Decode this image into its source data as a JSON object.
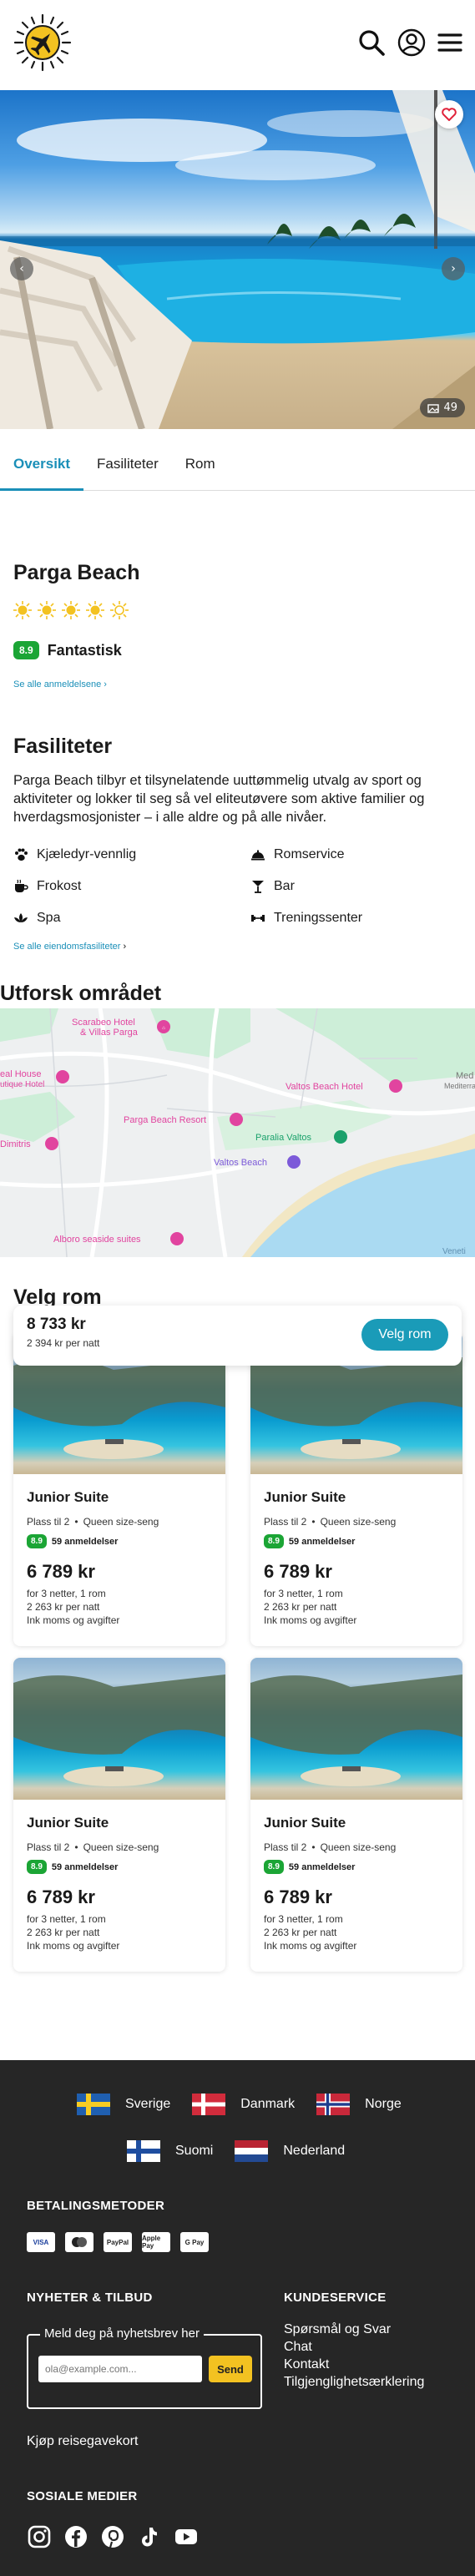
{
  "header": {
    "logo": "sun-plane-logo",
    "icons": [
      "search-icon",
      "user-icon",
      "menu-icon"
    ]
  },
  "hero": {
    "photo_count": "49"
  },
  "tabs": [
    {
      "label": "Oversikt",
      "active": true
    },
    {
      "label": "Fasiliteter",
      "active": false
    },
    {
      "label": "Rom",
      "active": false
    }
  ],
  "hotel": {
    "name": "Parga Beach",
    "sun_rating": 5,
    "score": "8.9",
    "score_label": "Fantastisk",
    "reviews_link": "Se alle anmeldelsene"
  },
  "facilities": {
    "title": "Fasiliteter",
    "description": "Parga Beach tilbyr et tilsynelatende uuttømmelig utvalg av sport og aktiviteter og lokker til seg så vel eliteutøvere som aktive familier og hverdagsmosjonister – i alle aldre og på alle nivåer.",
    "items": [
      {
        "label": "Kjæledyr-vennlig",
        "icon": "paw-icon"
      },
      {
        "label": "Romservice",
        "icon": "cloche-icon"
      },
      {
        "label": "Frokost",
        "icon": "coffee-icon"
      },
      {
        "label": "Bar",
        "icon": "cocktail-icon"
      },
      {
        "label": "Spa",
        "icon": "lotus-icon"
      },
      {
        "label": "Treningssenter",
        "icon": "dumbbell-icon"
      }
    ],
    "all_link": "Se alle eiendomsfasiliteter"
  },
  "area": {
    "title": "Utforsk området",
    "map_labels": {
      "scarabeo": "Scarabeo Hotel",
      "scarabeo2": "& Villas Parga",
      "bh1": "eal House",
      "bh2": "utique Hotel",
      "beach_house": "Valtos Beach Hotel",
      "dimitris": "Dimitris",
      "resort": "Parga Beach Resort",
      "paralia": "Paralia Valtos",
      "valtos": "Valtos Beach",
      "alboro": "Alboro seaside suites",
      "med1": "Med",
      "med2": "Mediterra",
      "veneti": "Veneti"
    }
  },
  "rooms": {
    "title": "Velg rom",
    "sticky": {
      "price": "8 733 kr",
      "per_night": "2 394 kr per natt",
      "button": "Velg rom"
    },
    "cards": [
      {
        "title": "Junior Suite",
        "capacity": "Plass til 2",
        "bed": "Queen size-seng",
        "score": "8.9",
        "reviews": "59 anmeldelser",
        "price": "6 789 kr",
        "stay": "for 3 netter, 1 rom",
        "per_night": "2 263 kr per natt",
        "tax": "Ink moms og avgifter"
      },
      {
        "title": "Junior Suite",
        "capacity": "Plass til 2",
        "bed": "Queen size-seng",
        "score": "8.9",
        "reviews": "59 anmeldelser",
        "price": "6 789 kr",
        "stay": "for 3 netter, 1 rom",
        "per_night": "2 263 kr per natt",
        "tax": "Ink moms og avgifter"
      },
      {
        "title": "Junior Suite",
        "capacity": "Plass til 2",
        "bed": "Queen size-seng",
        "score": "8.9",
        "reviews": "59 anmeldelser",
        "price": "6 789 kr",
        "stay": "for 3 netter, 1 rom",
        "per_night": "2 263 kr per natt",
        "tax": "Ink moms og avgifter"
      },
      {
        "title": "Junior Suite",
        "capacity": "Plass til 2",
        "bed": "Queen size-seng",
        "score": "8.9",
        "reviews": "59 anmeldelser",
        "price": "6 789 kr",
        "stay": "for 3 netter, 1 rom",
        "per_night": "2 263 kr per natt",
        "tax": "Ink moms og avgifter"
      }
    ]
  },
  "footer": {
    "countries": [
      {
        "name": "Sverige",
        "flag": "sweden-flag"
      },
      {
        "name": "Danmark",
        "flag": "denmark-flag"
      },
      {
        "name": "Norge",
        "flag": "norway-flag"
      },
      {
        "name": "Suomi",
        "flag": "finland-flag"
      },
      {
        "name": "Nederland",
        "flag": "netherlands-flag"
      }
    ],
    "payment_title": "BETALINGSMETODER",
    "payment_methods": [
      "VISA",
      "mastercard",
      "PayPal",
      "Apple Pay",
      "G Pay"
    ],
    "news_title": "NYHETER & TILBUD",
    "news_legend": "Meld deg på nyhetsbrev her",
    "news_placeholder": "ola@example.com...",
    "news_button": "Send",
    "gift_link": "Kjøp reisegavekort",
    "service_title": "KUNDESERVICE",
    "service_links": [
      "Spørsmål og Svar",
      "Chat",
      "Kontakt",
      "Tilgjenglighetsærklering"
    ],
    "social_title": "SOSIALE MEDIER",
    "social_icons": [
      "instagram-icon",
      "facebook-icon",
      "pinterest-icon",
      "tiktok-icon",
      "youtube-icon"
    ]
  },
  "colors": {
    "accent": "#1a8fb8",
    "rating_green": "#1ba535",
    "sun_yellow": "#f3c221",
    "footer_bg": "#262626"
  }
}
